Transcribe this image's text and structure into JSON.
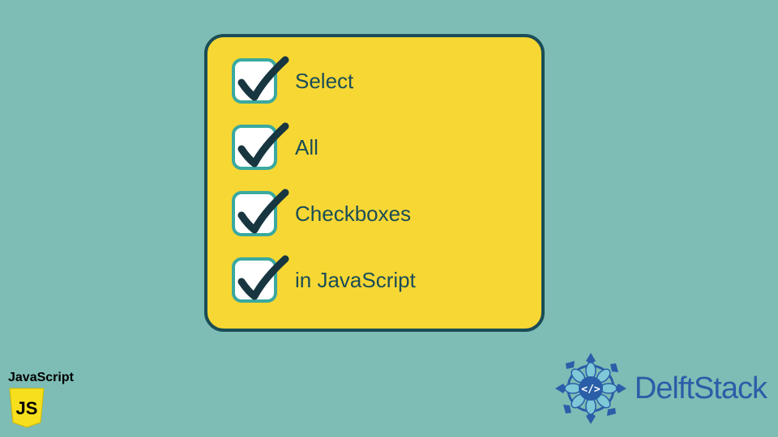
{
  "colors": {
    "background": "#7dbdb5",
    "card_bg": "#f7d734",
    "card_border": "#1a4d57",
    "checkbox_bg": "#ffffff",
    "checkbox_border": "#3aa9a0",
    "checkmark": "#183640",
    "text": "#1a4d57",
    "js_yellow": "#f7df1e",
    "delft_blue": "#2a5ea8"
  },
  "checklist": {
    "items": [
      {
        "label": "Select",
        "checked": true
      },
      {
        "label": "All",
        "checked": true
      },
      {
        "label": "Checkboxes",
        "checked": true
      },
      {
        "label": "in JavaScript",
        "checked": true
      }
    ]
  },
  "js_badge": {
    "text": "JavaScript",
    "shield_letters": "JS"
  },
  "delft": {
    "text": "DelftStack",
    "inner_symbol": "</>"
  }
}
